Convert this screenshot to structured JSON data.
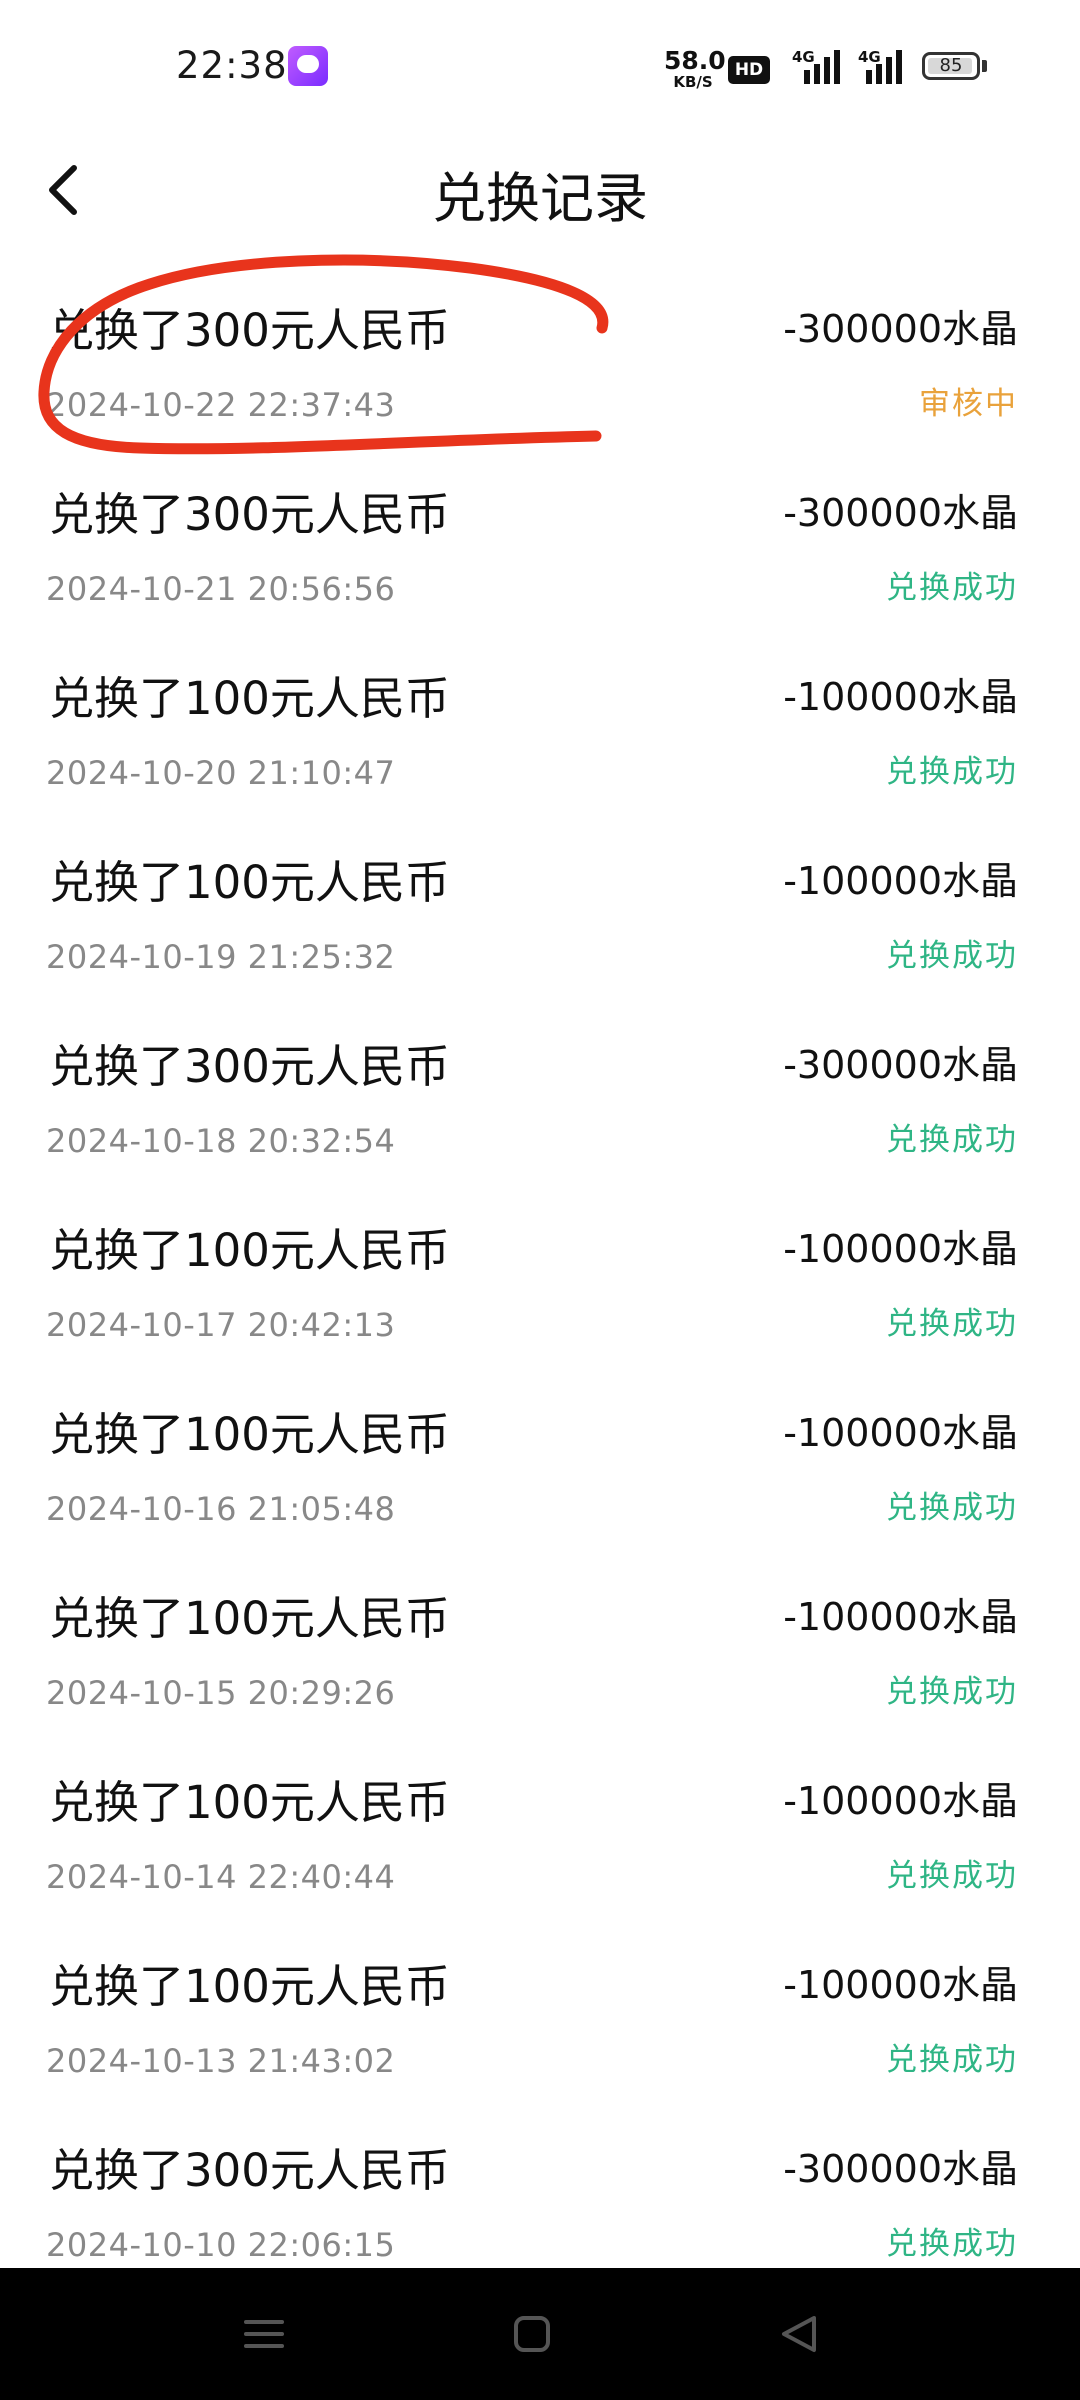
{
  "status_bar": {
    "time": "22:38",
    "net_speed_value": "58.0",
    "net_speed_unit": "KB/S",
    "hd_label": "HD",
    "signal_1_label": "4G",
    "signal_2_label": "4G",
    "battery_level": "85"
  },
  "header": {
    "title": "兑换记录"
  },
  "records": [
    {
      "title": "兑换了300元人民币",
      "time": "2024-10-22 22:37:43",
      "amount": "-300000水晶",
      "status": "审核中",
      "status_type": "pending"
    },
    {
      "title": "兑换了300元人民币",
      "time": "2024-10-21 20:56:56",
      "amount": "-300000水晶",
      "status": "兑换成功",
      "status_type": "success"
    },
    {
      "title": "兑换了100元人民币",
      "time": "2024-10-20 21:10:47",
      "amount": "-100000水晶",
      "status": "兑换成功",
      "status_type": "success"
    },
    {
      "title": "兑换了100元人民币",
      "time": "2024-10-19 21:25:32",
      "amount": "-100000水晶",
      "status": "兑换成功",
      "status_type": "success"
    },
    {
      "title": "兑换了300元人民币",
      "time": "2024-10-18 20:32:54",
      "amount": "-300000水晶",
      "status": "兑换成功",
      "status_type": "success"
    },
    {
      "title": "兑换了100元人民币",
      "time": "2024-10-17 20:42:13",
      "amount": "-100000水晶",
      "status": "兑换成功",
      "status_type": "success"
    },
    {
      "title": "兑换了100元人民币",
      "time": "2024-10-16 21:05:48",
      "amount": "-100000水晶",
      "status": "兑换成功",
      "status_type": "success"
    },
    {
      "title": "兑换了100元人民币",
      "time": "2024-10-15 20:29:26",
      "amount": "-100000水晶",
      "status": "兑换成功",
      "status_type": "success"
    },
    {
      "title": "兑换了100元人民币",
      "time": "2024-10-14 22:40:44",
      "amount": "-100000水晶",
      "status": "兑换成功",
      "status_type": "success"
    },
    {
      "title": "兑换了100元人民币",
      "time": "2024-10-13 21:43:02",
      "amount": "-100000水晶",
      "status": "兑换成功",
      "status_type": "success"
    },
    {
      "title": "兑换了300元人民币",
      "time": "2024-10-10 22:06:15",
      "amount": "-300000水晶",
      "status": "兑换成功",
      "status_type": "success"
    }
  ],
  "colors": {
    "success": "#2fb585",
    "pending": "#e9a23b",
    "annotation": "#e8341c"
  },
  "icons": {
    "back": "chevron-left-icon",
    "nav_menu": "menu-icon",
    "nav_home": "square-home-icon",
    "nav_back": "triangle-back-icon"
  }
}
